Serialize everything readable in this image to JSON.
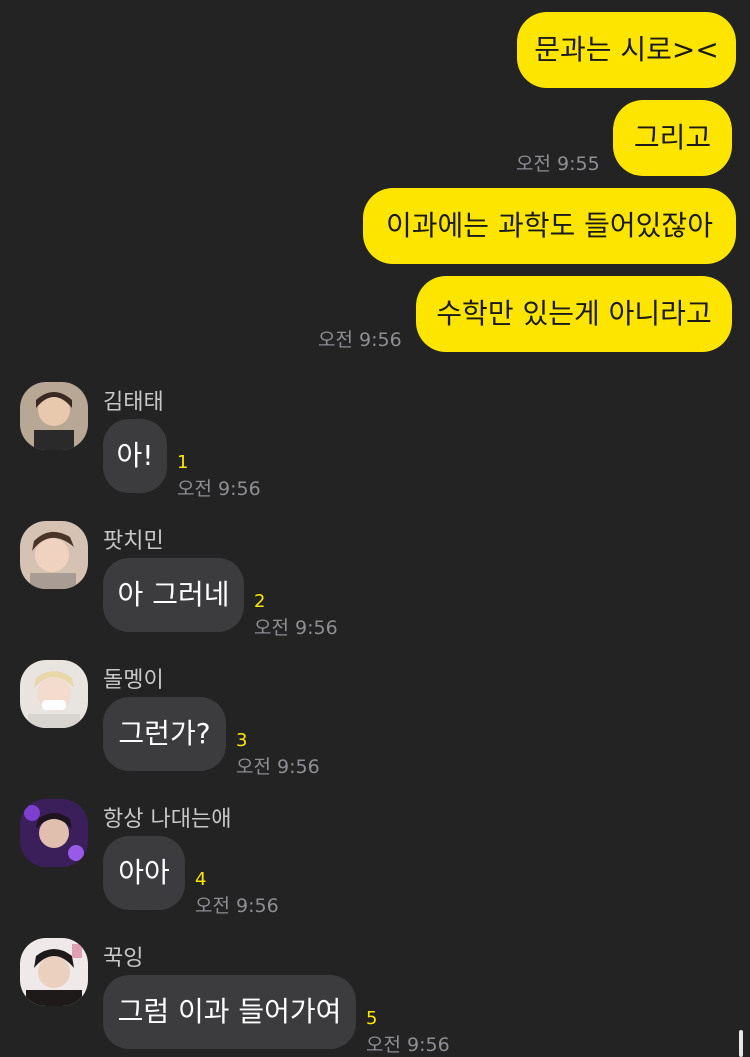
{
  "outgoing": [
    {
      "text": "문과는 시로><",
      "time": ""
    },
    {
      "text": "그리고",
      "time": "오전 9:55"
    },
    {
      "text": "이과에는 과학도 들어있잖아",
      "time": ""
    },
    {
      "text": "수학만 있는게 아니라고",
      "time": "오전 9:56"
    }
  ],
  "incoming": [
    {
      "sender": "김태태",
      "text": "아!",
      "unread": "1",
      "time": "오전 9:56"
    },
    {
      "sender": "팟치민",
      "text": "아 그러네",
      "unread": "2",
      "time": "오전 9:56"
    },
    {
      "sender": "돌멩이",
      "text": "그런가?",
      "unread": "3",
      "time": "오전 9:56"
    },
    {
      "sender": "항상 나대는애",
      "text": "아아",
      "unread": "4",
      "time": "오전 9:56"
    },
    {
      "sender": "꾹잉",
      "text": "그럼 이과 들어가여",
      "unread": "5",
      "time": "오전 9:56"
    }
  ],
  "colors": {
    "background": "#232324",
    "outgoing_bubble": "#FEE500",
    "incoming_bubble": "#3c3c3e",
    "unread_count": "#FEE500"
  }
}
